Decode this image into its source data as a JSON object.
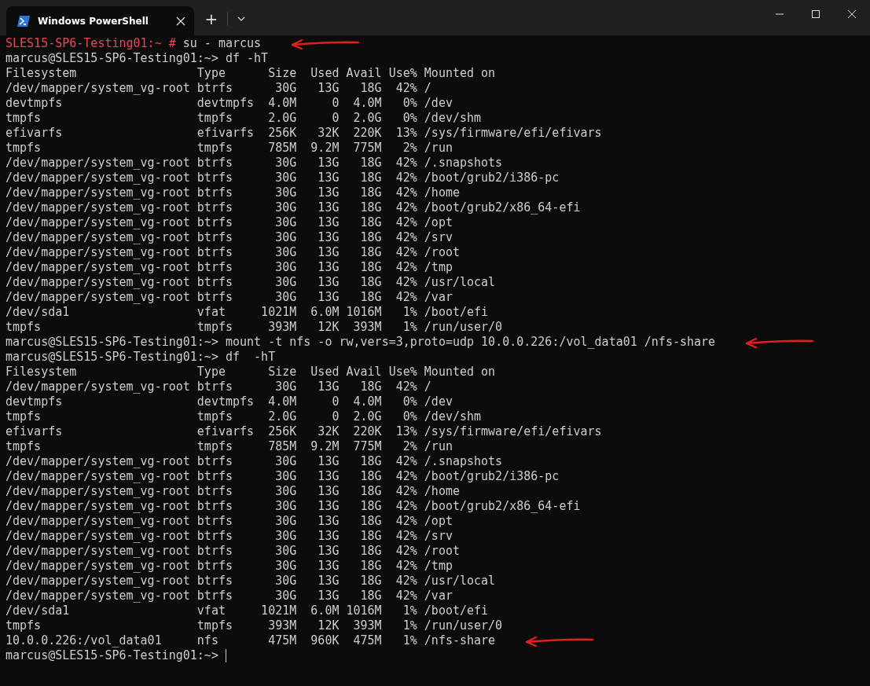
{
  "window": {
    "tab_title": "Windows PowerShell",
    "new_tab": "+"
  },
  "terminal": {
    "lines": [
      {
        "kind": "root_prompt",
        "prompt": "SLES15-SP6-Testing01:~ #",
        "command": "su - marcus",
        "marked": true
      },
      {
        "kind": "prompt",
        "prompt": "marcus@SLES15-SP6-Testing01:~>",
        "command": "df -hT",
        "marked": false,
        "cursor": false
      },
      {
        "kind": "output",
        "text": "Filesystem                 Type      Size  Used Avail Use% Mounted on",
        "marked": false
      },
      {
        "kind": "output",
        "text": "/dev/mapper/system_vg-root btrfs      30G   13G   18G  42% /",
        "marked": false
      },
      {
        "kind": "output",
        "text": "devtmpfs                   devtmpfs  4.0M     0  4.0M   0% /dev",
        "marked": false
      },
      {
        "kind": "output",
        "text": "tmpfs                      tmpfs     2.0G     0  2.0G   0% /dev/shm",
        "marked": false
      },
      {
        "kind": "output",
        "text": "efivarfs                   efivarfs  256K   32K  220K  13% /sys/firmware/efi/efivars",
        "marked": false
      },
      {
        "kind": "output",
        "text": "tmpfs                      tmpfs     785M  9.2M  775M   2% /run",
        "marked": false
      },
      {
        "kind": "output",
        "text": "/dev/mapper/system_vg-root btrfs      30G   13G   18G  42% /.snapshots",
        "marked": false
      },
      {
        "kind": "output",
        "text": "/dev/mapper/system_vg-root btrfs      30G   13G   18G  42% /boot/grub2/i386-pc",
        "marked": false
      },
      {
        "kind": "output",
        "text": "/dev/mapper/system_vg-root btrfs      30G   13G   18G  42% /home",
        "marked": false
      },
      {
        "kind": "output",
        "text": "/dev/mapper/system_vg-root btrfs      30G   13G   18G  42% /boot/grub2/x86_64-efi",
        "marked": false
      },
      {
        "kind": "output",
        "text": "/dev/mapper/system_vg-root btrfs      30G   13G   18G  42% /opt",
        "marked": false
      },
      {
        "kind": "output",
        "text": "/dev/mapper/system_vg-root btrfs      30G   13G   18G  42% /srv",
        "marked": false
      },
      {
        "kind": "output",
        "text": "/dev/mapper/system_vg-root btrfs      30G   13G   18G  42% /root",
        "marked": false
      },
      {
        "kind": "output",
        "text": "/dev/mapper/system_vg-root btrfs      30G   13G   18G  42% /tmp",
        "marked": false
      },
      {
        "kind": "output",
        "text": "/dev/mapper/system_vg-root btrfs      30G   13G   18G  42% /usr/local",
        "marked": false
      },
      {
        "kind": "output",
        "text": "/dev/mapper/system_vg-root btrfs      30G   13G   18G  42% /var",
        "marked": false
      },
      {
        "kind": "output",
        "text": "/dev/sda1                  vfat     1021M  6.0M 1016M   1% /boot/efi",
        "marked": false
      },
      {
        "kind": "output",
        "text": "tmpfs                      tmpfs     393M   12K  393M   1% /run/user/0",
        "marked": false
      },
      {
        "kind": "prompt",
        "prompt": "marcus@SLES15-SP6-Testing01:~>",
        "command": "mount -t nfs -o rw,vers=3,proto=udp 10.0.0.226:/vol_data01 /nfs-share",
        "marked": true,
        "cursor": false
      },
      {
        "kind": "prompt",
        "prompt": "marcus@SLES15-SP6-Testing01:~>",
        "command": "df  -hT",
        "marked": false,
        "cursor": false
      },
      {
        "kind": "output",
        "text": "Filesystem                 Type      Size  Used Avail Use% Mounted on",
        "marked": false
      },
      {
        "kind": "output",
        "text": "/dev/mapper/system_vg-root btrfs      30G   13G   18G  42% /",
        "marked": false
      },
      {
        "kind": "output",
        "text": "devtmpfs                   devtmpfs  4.0M     0  4.0M   0% /dev",
        "marked": false
      },
      {
        "kind": "output",
        "text": "tmpfs                      tmpfs     2.0G     0  2.0G   0% /dev/shm",
        "marked": false
      },
      {
        "kind": "output",
        "text": "efivarfs                   efivarfs  256K   32K  220K  13% /sys/firmware/efi/efivars",
        "marked": false
      },
      {
        "kind": "output",
        "text": "tmpfs                      tmpfs     785M  9.2M  775M   2% /run",
        "marked": false
      },
      {
        "kind": "output",
        "text": "/dev/mapper/system_vg-root btrfs      30G   13G   18G  42% /.snapshots",
        "marked": false
      },
      {
        "kind": "output",
        "text": "/dev/mapper/system_vg-root btrfs      30G   13G   18G  42% /boot/grub2/i386-pc",
        "marked": false
      },
      {
        "kind": "output",
        "text": "/dev/mapper/system_vg-root btrfs      30G   13G   18G  42% /home",
        "marked": false
      },
      {
        "kind": "output",
        "text": "/dev/mapper/system_vg-root btrfs      30G   13G   18G  42% /boot/grub2/x86_64-efi",
        "marked": false
      },
      {
        "kind": "output",
        "text": "/dev/mapper/system_vg-root btrfs      30G   13G   18G  42% /opt",
        "marked": false
      },
      {
        "kind": "output",
        "text": "/dev/mapper/system_vg-root btrfs      30G   13G   18G  42% /srv",
        "marked": false
      },
      {
        "kind": "output",
        "text": "/dev/mapper/system_vg-root btrfs      30G   13G   18G  42% /root",
        "marked": false
      },
      {
        "kind": "output",
        "text": "/dev/mapper/system_vg-root btrfs      30G   13G   18G  42% /tmp",
        "marked": false
      },
      {
        "kind": "output",
        "text": "/dev/mapper/system_vg-root btrfs      30G   13G   18G  42% /usr/local",
        "marked": false
      },
      {
        "kind": "output",
        "text": "/dev/mapper/system_vg-root btrfs      30G   13G   18G  42% /var",
        "marked": false
      },
      {
        "kind": "output",
        "text": "/dev/sda1                  vfat     1021M  6.0M 1016M   1% /boot/efi",
        "marked": false
      },
      {
        "kind": "output",
        "text": "tmpfs                      tmpfs     393M   12K  393M   1% /run/user/0",
        "marked": false
      },
      {
        "kind": "output",
        "text": "10.0.0.226:/vol_data01     nfs       475M  960K  475M   1% /nfs-share",
        "marked": true
      },
      {
        "kind": "prompt",
        "prompt": "marcus@SLES15-SP6-Testing01:~>",
        "marked": false,
        "cursor": true
      }
    ]
  }
}
